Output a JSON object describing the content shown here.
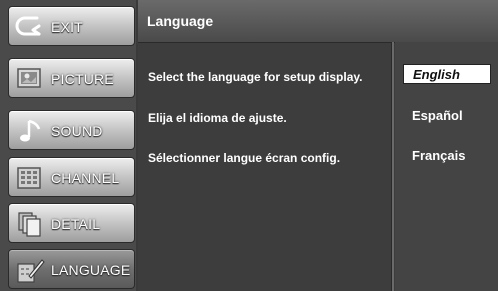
{
  "sidebar": {
    "items": [
      {
        "label": "EXIT",
        "icon": "exit-arrow-icon"
      },
      {
        "label": "PICTURE",
        "icon": "picture-icon"
      },
      {
        "label": "SOUND",
        "icon": "music-note-icon"
      },
      {
        "label": "CHANNEL",
        "icon": "channel-grid-icon"
      },
      {
        "label": "DETAIL",
        "icon": "detail-pages-icon"
      },
      {
        "label": "LANGUAGE",
        "icon": "language-pen-icon"
      }
    ],
    "active_index": 5
  },
  "panel": {
    "title": "Language",
    "prompts": [
      "Select the language for setup display.",
      "Elija el idioma de ajuste.",
      "Sélectionner langue écran config."
    ],
    "options": [
      "English",
      "Español",
      "Français"
    ],
    "selected_index": 0
  },
  "colors": {
    "selected_option_bg": "#ffffff",
    "selected_option_text": "#111111"
  }
}
